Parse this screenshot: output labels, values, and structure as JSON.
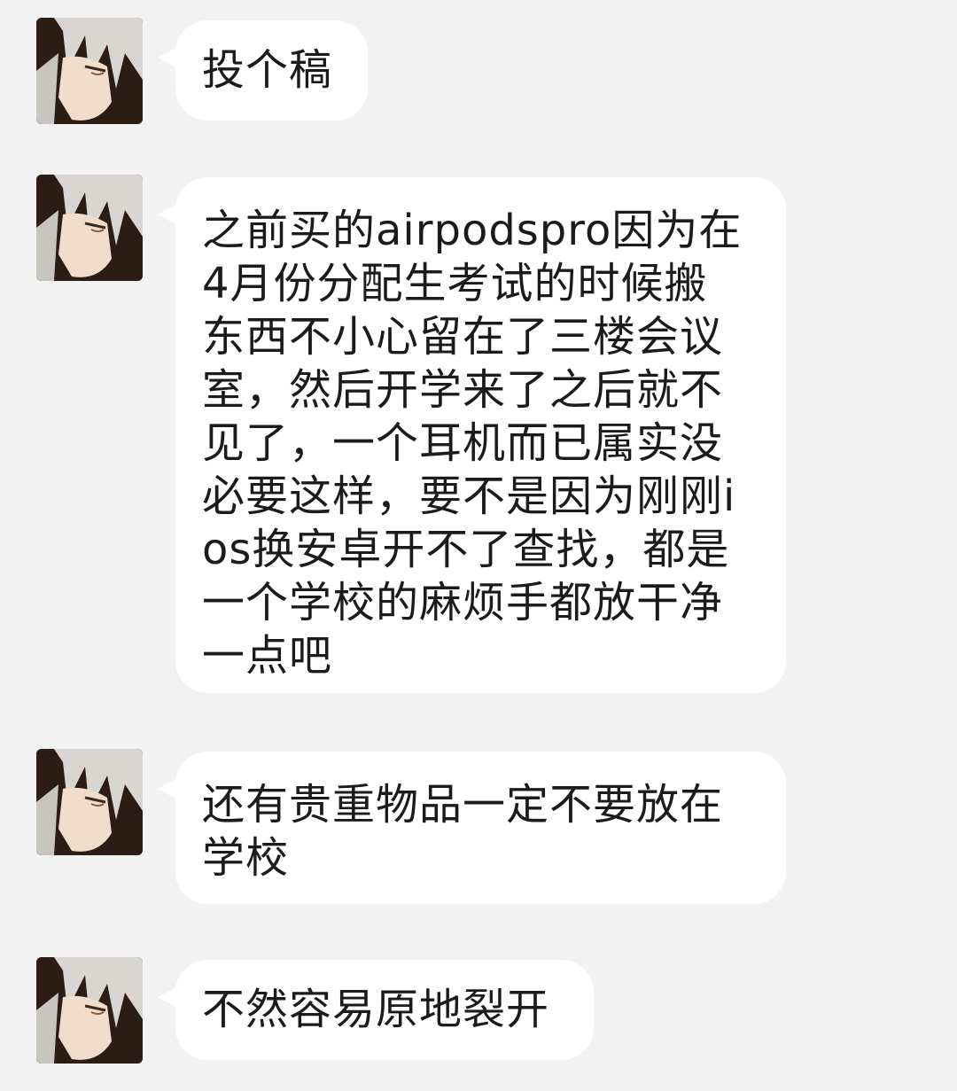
{
  "messages": [
    {
      "sender_avatar": "anime-avatar",
      "text": "投个稿"
    },
    {
      "sender_avatar": "anime-avatar",
      "text": "之前买的airpodspro因为在4月份分配生考试的时候搬东西不小心留在了三楼会议室，然后开学来了之后就不见了，一个耳机而已属实没必要这样，要不是因为刚刚ios换安卓开不了查找，都是一个学校的麻烦手都放干净一点吧"
    },
    {
      "sender_avatar": "anime-avatar",
      "text": "还有贵重物品一定不要放在学校"
    },
    {
      "sender_avatar": "anime-avatar",
      "text": "不然容易原地裂开"
    }
  ],
  "colors": {
    "background": "#f2f2f3",
    "bubble": "#ffffff",
    "text": "#1b1b1b"
  }
}
